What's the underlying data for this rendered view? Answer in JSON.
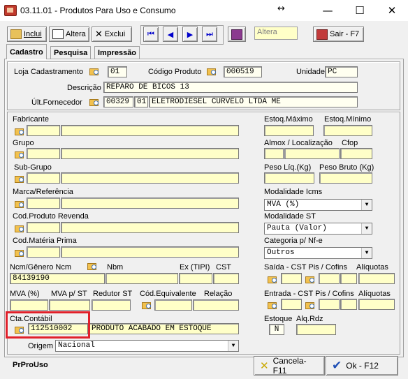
{
  "window": {
    "title": "03.11.01 - Produtos Para Uso e Consumo",
    "resize_glyph": "↔",
    "minimize": "—",
    "maximize": "☐",
    "close": "✕"
  },
  "toolbar": {
    "include": "Inclui",
    "alter": "Altera",
    "delete": "Exclui",
    "nav_first": "⏮",
    "nav_prev": "◀",
    "nav_next": "▶",
    "nav_last": "⏭",
    "mode": "Altera",
    "exit": "Sair - F7"
  },
  "tabs": [
    "Cadastro",
    "Pesquisa",
    "Impressão"
  ],
  "header": {
    "loja_label": "Loja Cadastramento",
    "loja_value": "01",
    "codigo_label": "Código Produto",
    "codigo_value": "000519",
    "unidade_label": "Unidade",
    "unidade_value": "PC",
    "descricao_label": "Descrição",
    "descricao_value": "REPARO DE BICOS 13",
    "fornecedor_label": "Últ.Fornecedor",
    "fornecedor_code": "00329",
    "fornecedor_loja": "01",
    "fornecedor_name": "ELETRODIESEL CURVELO LTDA ME"
  },
  "fields": {
    "fabricante": "Fabricante",
    "grupo": "Grupo",
    "subgrupo": "Sub-Grupo",
    "marca": "Marca/Referência",
    "cod_revenda": "Cod.Produto Revenda",
    "cod_materia": "Cod.Matéria Prima",
    "ncm_label": "Ncm/Gênero Ncm",
    "ncm_value": "84139190",
    "nbm": "Nbm",
    "ex_tipi": "Ex (TIPI)",
    "cst": "CST",
    "mva": "MVA (%)",
    "mva_st": "MVA p/ ST",
    "redutor": "Redutor ST",
    "cod_equiv": "Cód.Equivalente",
    "relacao": "Relação",
    "cta_label": "Cta.Contábil",
    "cta_value": "112510002",
    "cta_desc": "PRODUTO ACABADO EM ESTOQUE",
    "origem_label": "Origem",
    "origem_value": "Nacional"
  },
  "right": {
    "estoq_max": "Estoq.Máximo",
    "estoq_min": "Estoq.Mínimo",
    "almox": "Almox / Localização",
    "cfop": "Cfop",
    "peso_liq": "Peso Líq.(Kg)",
    "peso_bruto": "Peso Bruto (Kg)",
    "modalidade_icms": "Modalidade Icms",
    "modalidade_icms_value": "MVA (%)",
    "modalidade_st": "Modalidade ST",
    "modalidade_st_value": "Pauta (Valor)",
    "categoria": "Categoria p/ Nf-e",
    "categoria_value": "Outros",
    "saida": "Saída - CST Pis / Cofins",
    "aliquotas1": "Alíquotas",
    "entrada": "Entrada - CST Pis / Cofins",
    "aliquotas2": "Alíquotas",
    "estoque": "Estoque",
    "estoque_value": "N",
    "alq_rdz": "Alq.Rdz"
  },
  "footer": {
    "program": "PrProUso",
    "cancel": "Cancela-F11",
    "ok": "Ok - F12"
  }
}
